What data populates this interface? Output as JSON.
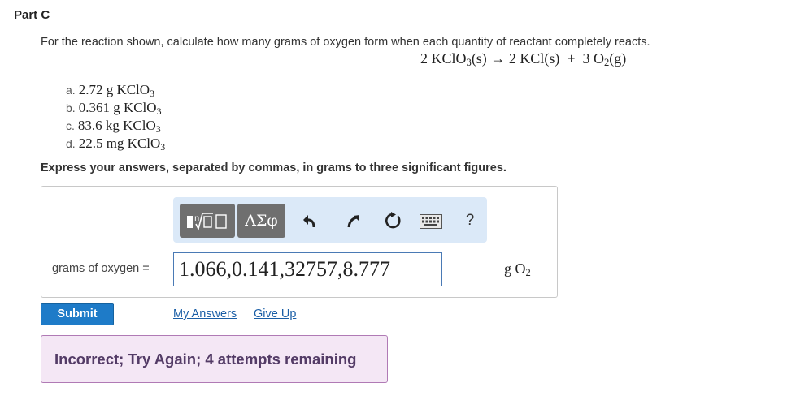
{
  "part": {
    "title": "Part C"
  },
  "question": {
    "text": "For the reaction shown, calculate how many grams of oxygen form when each quantity of reactant completely reacts.",
    "equation": {
      "c1": "2",
      "r_main": "KClO",
      "r_sub": "3",
      "r_state": "(s)",
      "arrow": "→",
      "c2": "2",
      "p1": "KCl(s)",
      "plus": "+",
      "c3": "3",
      "p2_main": "O",
      "p2_sub": "2",
      "p2_state": "(g)"
    },
    "items": [
      {
        "label": "a.",
        "amount": "2.72 g",
        "formula": "KClO",
        "sub": "3"
      },
      {
        "label": "b.",
        "amount": "0.361 g",
        "formula": "KClO",
        "sub": "3"
      },
      {
        "label": "c.",
        "amount": "83.6 kg",
        "formula": "KClO",
        "sub": "3"
      },
      {
        "label": "d.",
        "amount": "22.5 mg",
        "formula": "KClO",
        "sub": "3"
      }
    ]
  },
  "instructions": "Express your answers, separated by commas, in grams to three significant figures.",
  "toolbar": {
    "greek_label": "ΑΣφ",
    "help_label": "?",
    "undo_icon": "undo-arrow-icon",
    "redo_icon": "redo-arrow-icon",
    "reset_icon": "reset-circular-arrow-icon",
    "keyboard_icon": "keyboard-icon",
    "template_icon": "math-template-icon"
  },
  "answer": {
    "label": "grams of oxygen =",
    "value": "1.066,0.141,32757,8.777",
    "unit_main": "g O",
    "unit_sub": "2"
  },
  "actions": {
    "submit": "Submit",
    "my_answers": "My Answers",
    "give_up": "Give Up"
  },
  "feedback": {
    "text": "Incorrect; Try Again; 4 attempts remaining"
  },
  "colors": {
    "submit_bg": "#1e7bc8",
    "link": "#1a5ea6",
    "feedback_bg": "#f4e7f5",
    "feedback_border": "#b07ab5",
    "toolbar_bg": "#dbe9f8"
  }
}
